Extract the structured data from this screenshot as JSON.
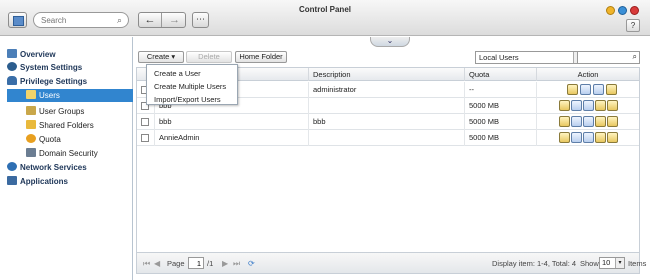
{
  "window": {
    "title": "Control Panel"
  },
  "search": {
    "placeholder": "Search"
  },
  "sidebar": {
    "sections": [
      {
        "label": "Overview"
      },
      {
        "label": "System Settings"
      },
      {
        "label": "Privilege Settings"
      }
    ],
    "privilege_items": [
      {
        "label": "Users",
        "selected": true
      },
      {
        "label": "User Groups"
      },
      {
        "label": "Shared Folders"
      },
      {
        "label": "Quota"
      },
      {
        "label": "Domain Security"
      }
    ],
    "after_sections": [
      {
        "label": "Network Services"
      },
      {
        "label": "Applications"
      }
    ]
  },
  "toolbar": {
    "create_label": "Create",
    "create_arrow": "▾",
    "delete_label": "Delete",
    "home_folder_label": "Home Folder",
    "user_type_value": "Local Users"
  },
  "create_menu": {
    "items": [
      "Create a User",
      "Create Multiple Users",
      "Import/Export Users"
    ]
  },
  "table": {
    "headers": {
      "description": "Description",
      "quota": "Quota",
      "action": "Action"
    },
    "rows": [
      {
        "name": "",
        "description": "administrator",
        "quota": "--"
      },
      {
        "name": "bbb",
        "description": "",
        "quota": "5000 MB"
      },
      {
        "name": "bbb",
        "description": "bbb",
        "quota": "5000 MB"
      },
      {
        "name": "AnnieAdmin",
        "description": "",
        "quota": "5000 MB"
      }
    ]
  },
  "pager": {
    "page_label": "Page",
    "page_value": "1",
    "total_pages": "/1",
    "display_text": "Display item: 1-4, Total: 4",
    "show_label": "Show",
    "show_value": "10",
    "items_label": "Items"
  },
  "colors": {
    "selection": "#3185cf",
    "header_text": "#20385a"
  }
}
